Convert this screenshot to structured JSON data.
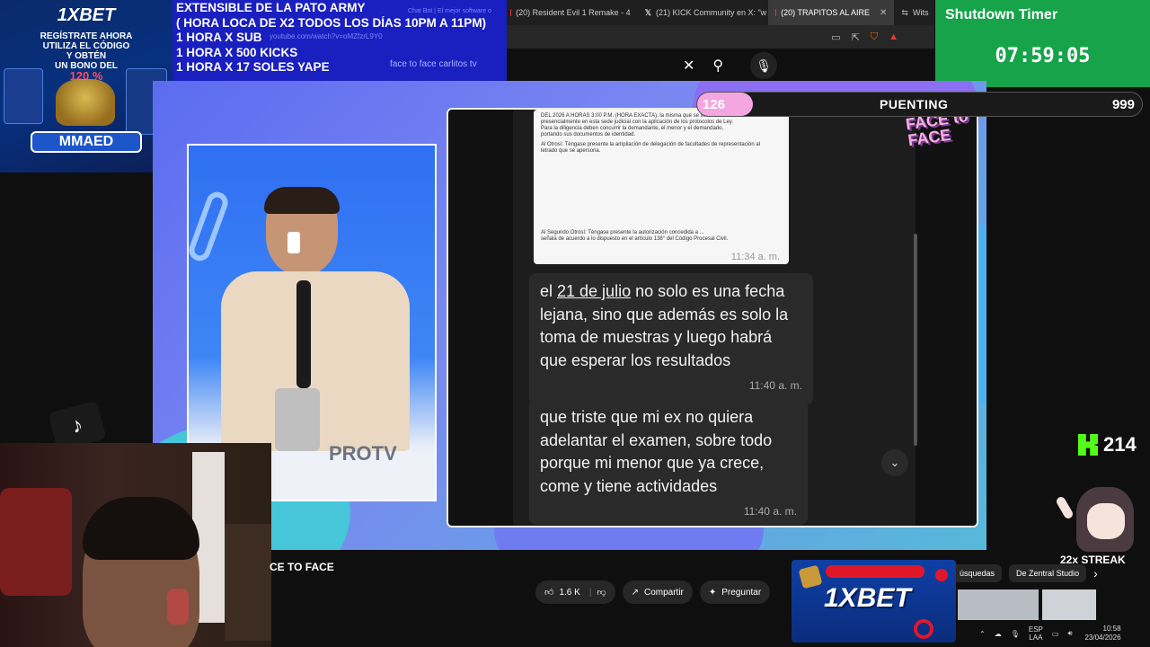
{
  "overlay": {
    "lines": [
      "EXTENSIBLE  DE LA PATO ARMY",
      "( HORA LOCA DE X2 TODOS LOS DÍAS 10PM A 11PM)",
      "1 HORA X SUB",
      "1 HORA X 500 KICKS",
      "1 HORA X 17 SOLES YAPE"
    ],
    "search_query": "face to face carlitos tv",
    "faint_url": "youtube.com/watch?v=oMZfzrL9Y0",
    "faint_tab": "Chat Bot | El mejor software o"
  },
  "browser": {
    "tabs": [
      {
        "label": "(20) Resident Evil 1 Remake - 4",
        "icon": "youtube-icon"
      },
      {
        "label": "(21) KICK Community en X: \"w",
        "icon": "x-icon"
      },
      {
        "label": "(20) TRAPITOS AL AIRE",
        "icon": "youtube-icon",
        "active": true
      },
      {
        "label": "Wits",
        "icon": "generic-icon"
      }
    ]
  },
  "promo_top": {
    "brand": "1XBET",
    "lines": [
      "REGÍSTRATE AHORA",
      "UTILIZA EL CÓDIGO",
      "Y OBTÉN",
      "UN BONO DEL"
    ],
    "percent": "120 %",
    "code": "MMAED"
  },
  "timer": {
    "title": "Shutdown Timer",
    "value": "07:59:05"
  },
  "goal": {
    "current": "126",
    "label": "PUENTING",
    "target": "999",
    "progress_fraction": 0.126
  },
  "video": {
    "watermark": "PROTV",
    "brand_logo": "FACE to FACE",
    "doc_lines": [
      "DEL 2026 A HORAS 3:00 P.M. (HORA EXACTA), la misma que se llevará a cabo",
      "presencialmente en esta sede judicial con la aplicación de los protocolos de Ley.",
      "Para la diligencia deben concurrir la demandante, el menor y el demandado,",
      "portando sus documentos de identidad.",
      "Al Otrosí: Téngase presente la ampliación de delegación de facultades de representación al",
      "letrado que se apersona.",
      "Al Segundo Otrosí: Téngase presente la autorización concedida a ...",
      "señala de acuerdo a lo dispuesto en el artículo 138° del Código Procesal Civil."
    ],
    "doc_time": "11:34 a. m.",
    "bubble1_pre": "el ",
    "bubble1_link": "21 de julio",
    "bubble1_post": " no solo es una fecha lejana, sino que además es solo la toma de muestras y luego habrá que esperar los resultados",
    "bubble1_time": "11:40 a. m.",
    "bubble2": "que triste que mi ex no quiera adelantar el examen, sobre todo porque mi menor que ya crece, come y tiene actividades",
    "bubble2_time": "11:40 a. m."
  },
  "kick": {
    "count": "214"
  },
  "streak": "22x STREAK",
  "youtube": {
    "title_fragment": "CE TO FACE",
    "likes": "1.6 K",
    "share": "Compartir",
    "ask": "Preguntar",
    "chips": [
      "úsquedas",
      "De Zentral Studio"
    ]
  },
  "promo_bottom": {
    "brand": "1XBET"
  },
  "taskbar": {
    "lang_top": "ESP",
    "lang_bottom": "LAA",
    "time": "10:58",
    "date": "23/04/2026"
  },
  "colors": {
    "timer_bg": "#16a34a",
    "overlay_bg": "#1a1fbf",
    "goal_fill": "#f3a6e2",
    "kick_green": "#53fc18"
  }
}
